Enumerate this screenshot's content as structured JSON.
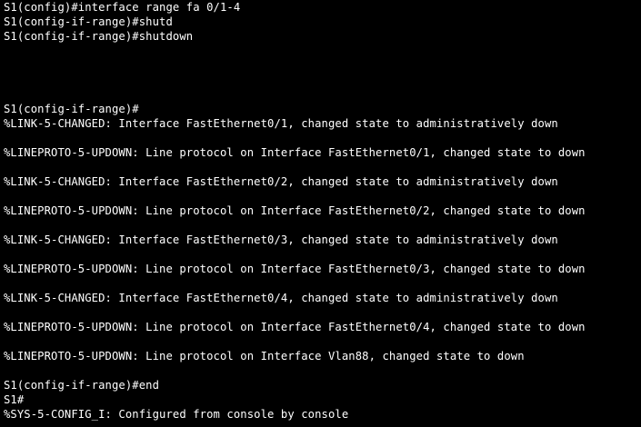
{
  "theme": {
    "background": "#000000",
    "text": "#ffffff"
  },
  "terminal": {
    "lines": [
      "S1(config)#interface range fa 0/1-4",
      "S1(config-if-range)#shutd",
      "S1(config-if-range)#shutdown",
      "S1(config-if-range)#",
      "%LINK-5-CHANGED: Interface FastEthernet0/1, changed state to administratively down",
      "%LINEPROTO-5-UPDOWN: Line protocol on Interface FastEthernet0/1, changed state to down",
      "%LINK-5-CHANGED: Interface FastEthernet0/2, changed state to administratively down",
      "%LINEPROTO-5-UPDOWN: Line protocol on Interface FastEthernet0/2, changed state to down",
      "%LINK-5-CHANGED: Interface FastEthernet0/3, changed state to administratively down",
      "%LINEPROTO-5-UPDOWN: Line protocol on Interface FastEthernet0/3, changed state to down",
      "%LINK-5-CHANGED: Interface FastEthernet0/4, changed state to administratively down",
      "%LINEPROTO-5-UPDOWN: Line protocol on Interface FastEthernet0/4, changed state to down",
      "%LINEPROTO-5-UPDOWN: Line protocol on Interface Vlan88, changed state to down",
      "S1(config-if-range)#end",
      "S1#",
      "%SYS-5-CONFIG_I: Configured from console by console"
    ]
  }
}
